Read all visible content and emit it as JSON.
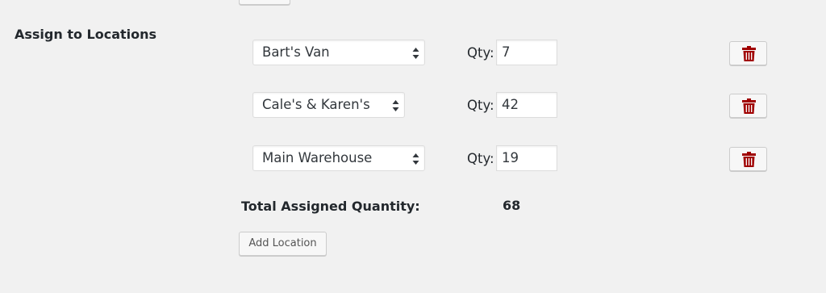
{
  "section": {
    "title": "Assign to Locations"
  },
  "rows": [
    {
      "location": "Bart's Van",
      "qty_label": "Qty:",
      "qty": "7"
    },
    {
      "location": "Cale's & Karen's",
      "qty_label": "Qty:",
      "qty": "42"
    },
    {
      "location": "Main Warehouse",
      "qty_label": "Qty:",
      "qty": "19"
    }
  ],
  "icons": {
    "delete": "trash-icon",
    "select_arrows": "select-arrows-icon"
  },
  "total": {
    "label": "Total Assigned Quantity:",
    "value": "68"
  },
  "actions": {
    "add_location": "Add Location"
  },
  "colors": {
    "background": "#f1f1f1",
    "trash": "#a00000"
  }
}
